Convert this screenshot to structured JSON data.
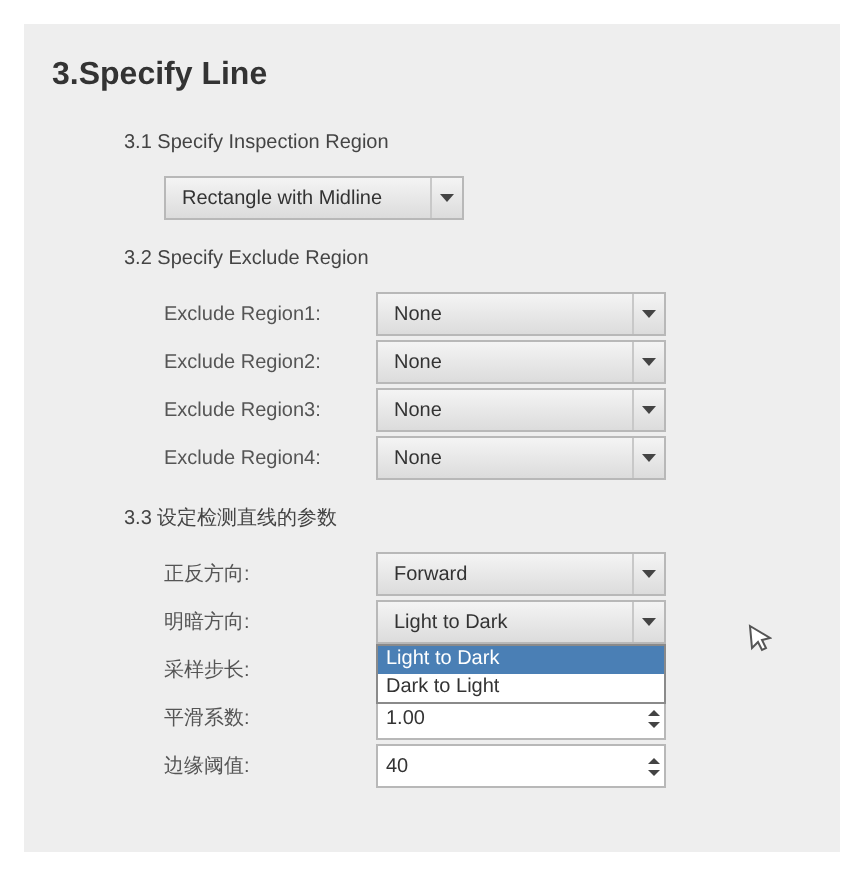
{
  "title": "3.Specify Line",
  "sections": [
    {
      "heading": "3.1 Specify Inspection Region",
      "rows": [
        {
          "kind": "combo",
          "value": "Rectangle with Midline"
        }
      ]
    },
    {
      "heading": "3.2 Specify Exclude Region",
      "rows": [
        {
          "kind": "combo",
          "label": "Exclude Region1:",
          "value": "None"
        },
        {
          "kind": "combo",
          "label": "Exclude Region2:",
          "value": "None"
        },
        {
          "kind": "combo",
          "label": "Exclude Region3:",
          "value": "None"
        },
        {
          "kind": "combo",
          "label": "Exclude Region4:",
          "value": "None"
        }
      ]
    },
    {
      "heading": "3.3 设定检测直线的参数",
      "rows": [
        {
          "kind": "combo",
          "label": "正反方向:",
          "value": "Forward"
        },
        {
          "kind": "combo",
          "label": "明暗方向:",
          "value": "Light to Dark",
          "options": [
            {
              "label": "Light to Dark",
              "selected": true
            },
            {
              "label": "Dark to Light",
              "selected": false
            }
          ]
        },
        {
          "kind": "covered",
          "label": "采样步长:"
        },
        {
          "kind": "spin",
          "label": "平滑系数:",
          "value": "1.00"
        },
        {
          "kind": "spin",
          "label": "边缘阈值:",
          "value": "40"
        }
      ]
    }
  ]
}
